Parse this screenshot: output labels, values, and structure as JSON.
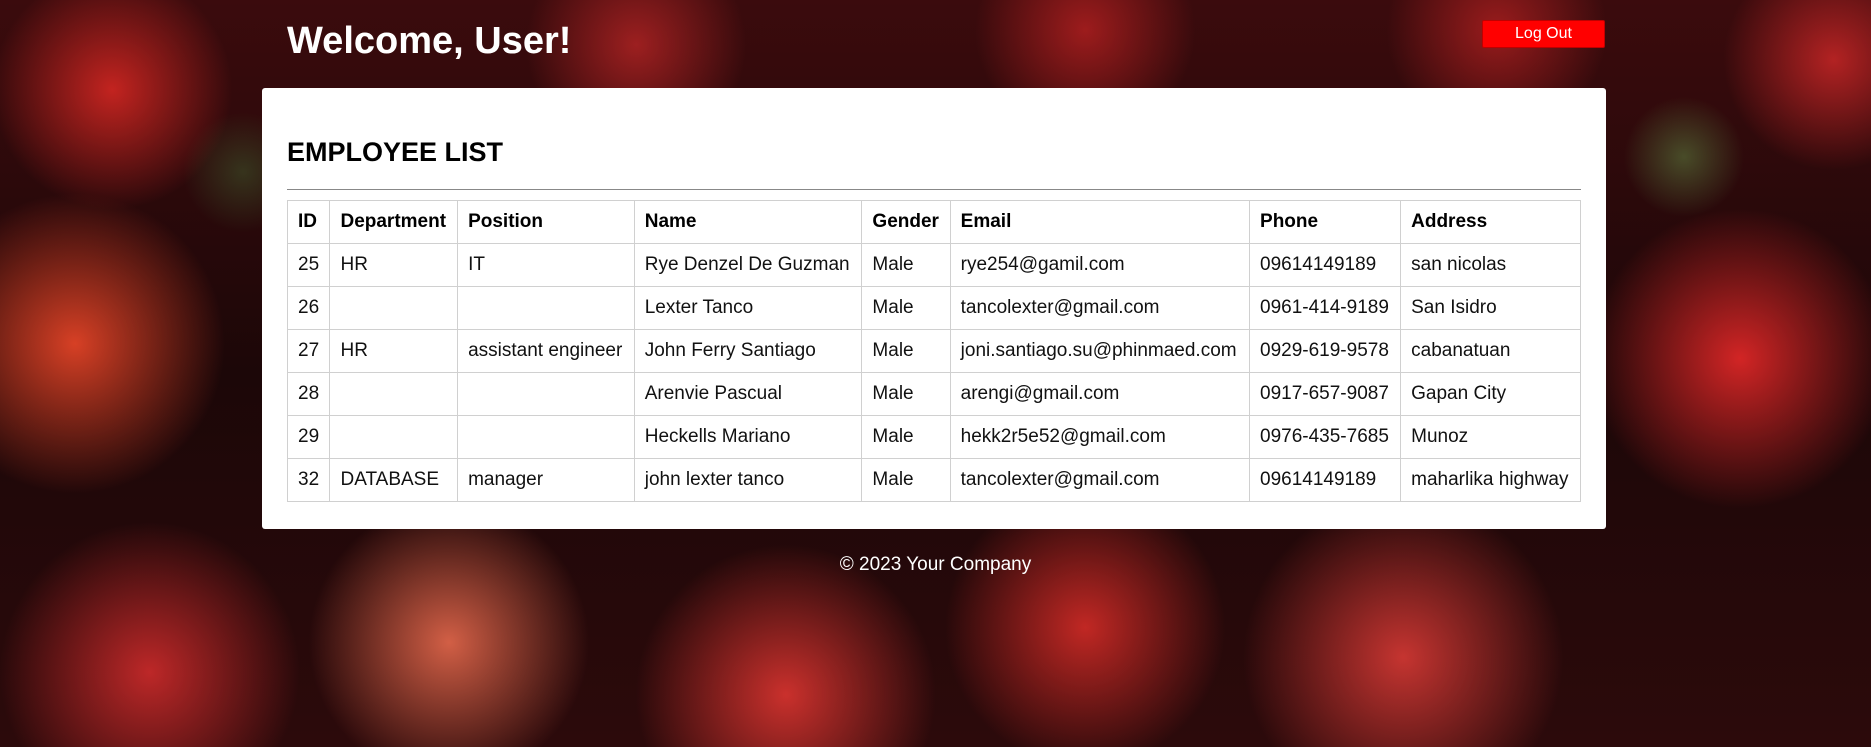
{
  "header": {
    "welcome_text": "Welcome, User!",
    "logout_label": "Log Out"
  },
  "panel": {
    "title": "EMPLOYEE LIST"
  },
  "table": {
    "columns": [
      "ID",
      "Department",
      "Position",
      "Name",
      "Gender",
      "Email",
      "Phone",
      "Address"
    ],
    "rows": [
      [
        "25",
        "HR",
        "IT",
        "Rye Denzel De Guzman",
        "Male",
        "rye254@gamil.com",
        "09614149189",
        "san nicolas"
      ],
      [
        "26",
        "",
        "",
        "Lexter Tanco",
        "Male",
        "tancolexter@gmail.com",
        "0961-414-9189",
        "San Isidro"
      ],
      [
        "27",
        "HR",
        "assistant engineer",
        "John Ferry Santiago",
        "Male",
        "joni.santiago.su@phinmaed.com",
        "0929-619-9578",
        "cabanatuan"
      ],
      [
        "28",
        "",
        "",
        "Arenvie Pascual",
        "Male",
        "arengi@gmail.com",
        "0917-657-9087",
        "Gapan City"
      ],
      [
        "29",
        "",
        "",
        "Heckells Mariano",
        "Male",
        "hekk2r5e52@gmail.com",
        "0976-435-7685",
        "Munoz"
      ],
      [
        "32",
        "DATABASE",
        "manager",
        "john lexter tanco",
        "Male",
        "tancolexter@gmail.com",
        "09614149189",
        "maharlika highway"
      ]
    ]
  },
  "footer": {
    "text": "© 2023 Your Company"
  },
  "colors": {
    "logout_button": "#ff0000",
    "panel_background": "#ffffff",
    "header_text": "#ffffff"
  }
}
